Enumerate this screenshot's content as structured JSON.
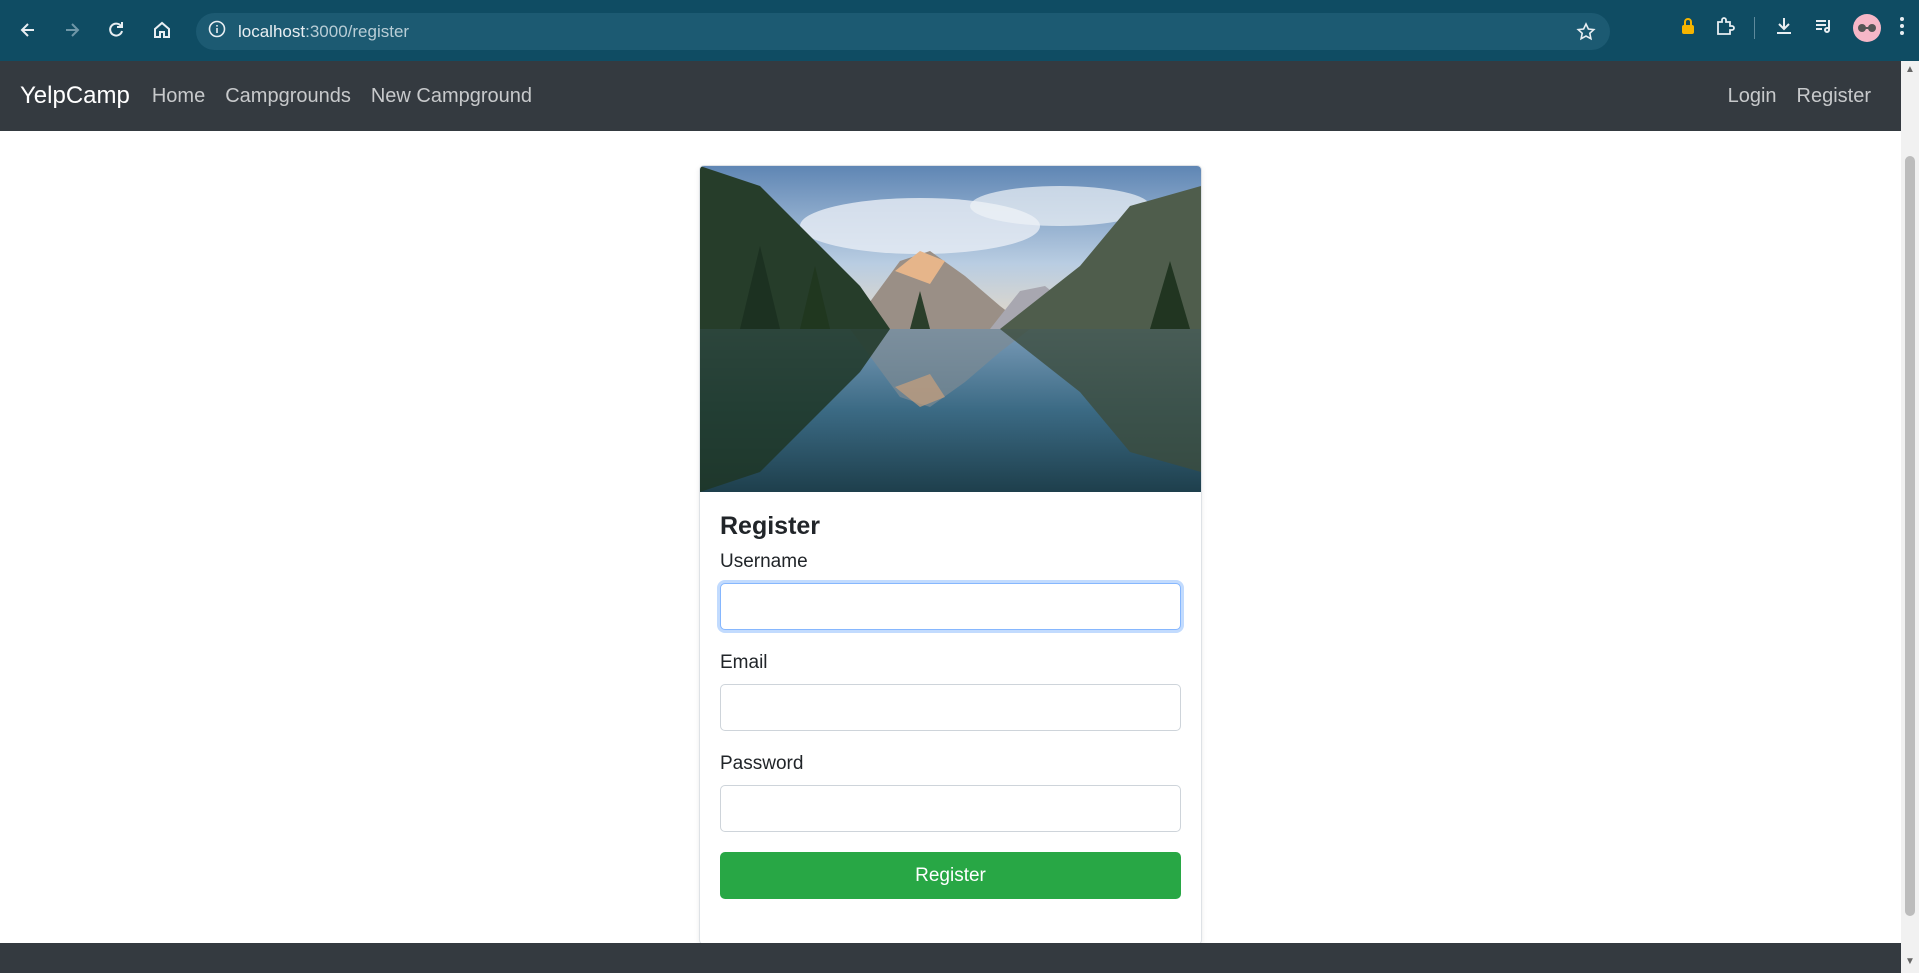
{
  "browser": {
    "url_host": "localhost",
    "url_path": ":3000/register"
  },
  "nav": {
    "brand": "YelpCamp",
    "links": [
      "Home",
      "Campgrounds",
      "New Campground"
    ],
    "right_links": [
      "Login",
      "Register"
    ]
  },
  "card": {
    "title": "Register",
    "fields": [
      {
        "label": "Username",
        "value": ""
      },
      {
        "label": "Email",
        "value": ""
      },
      {
        "label": "Password",
        "value": ""
      }
    ],
    "submit_label": "Register"
  },
  "colors": {
    "browser_bar": "#0f4c63",
    "navbar": "#343a40",
    "submit": "#28a745"
  }
}
